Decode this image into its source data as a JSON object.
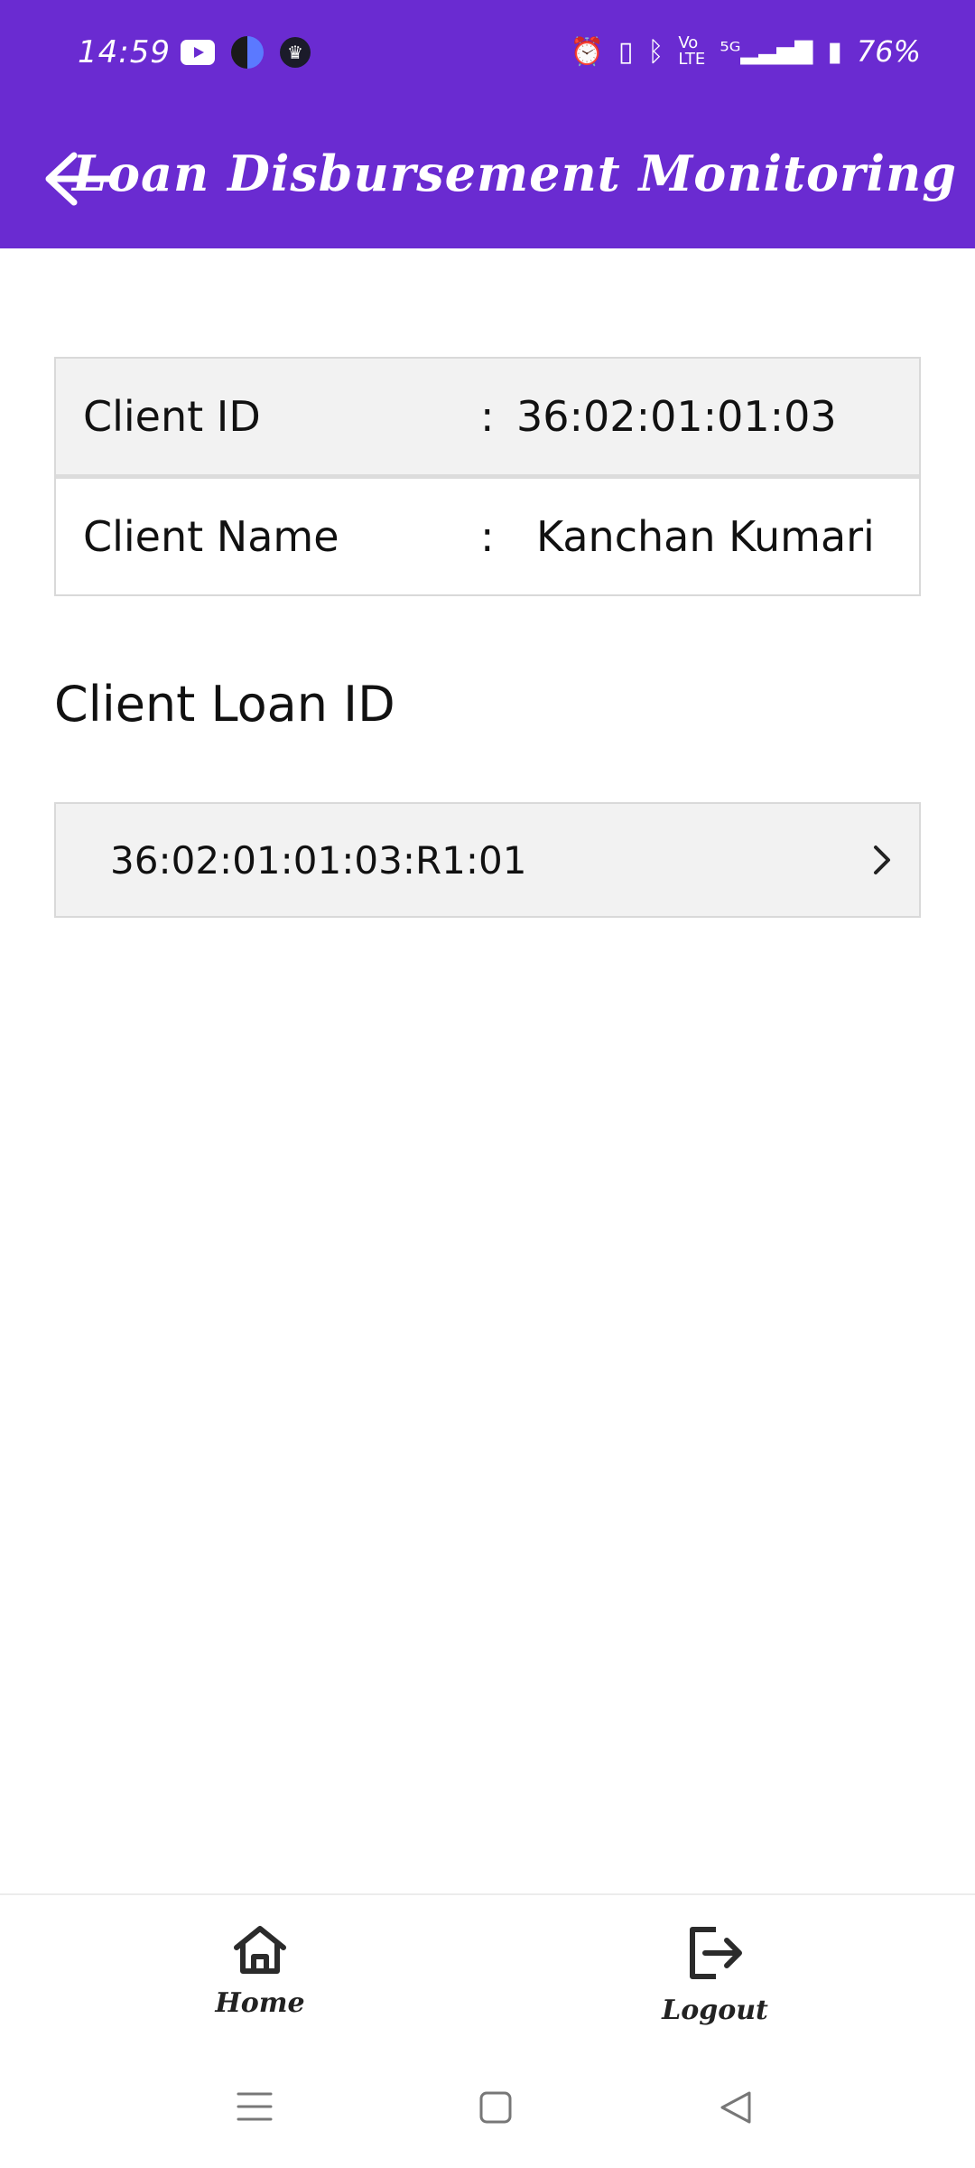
{
  "status_bar": {
    "time": "14:59",
    "battery": "76%",
    "icons": [
      "youtube-icon",
      "app-icon",
      "crown-icon",
      "alarm-icon",
      "vibrate-icon",
      "bluetooth-icon",
      "volte-icon",
      "5g-signal-icon",
      "battery-icon"
    ]
  },
  "app_bar": {
    "title": "Loan Disbursement Monitoring",
    "back_icon": "arrow-left-icon",
    "background": "#6a2bd1"
  },
  "client_info": {
    "client_id_label": "Client ID",
    "client_id_colon": ":",
    "client_id_value": "36:02:01:01:03",
    "client_name_label": "Client Name",
    "client_name_colon": ":",
    "client_name_value": "Kanchan Kumari"
  },
  "loan_section": {
    "title": "Client Loan ID",
    "items": [
      {
        "loan_id": "36:02:01:01:03:R1:01"
      }
    ]
  },
  "bottom_nav": {
    "home_label": "Home",
    "logout_label": "Logout"
  }
}
